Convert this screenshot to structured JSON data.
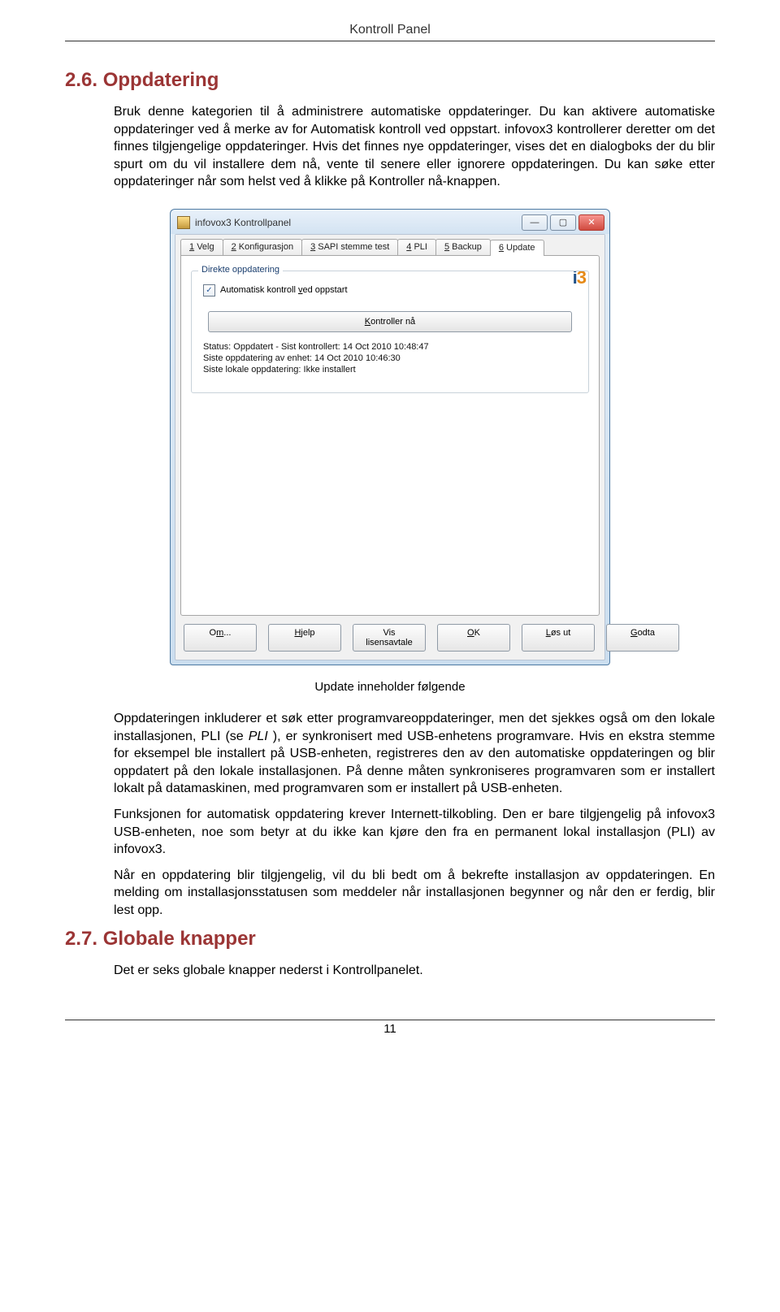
{
  "header": {
    "title": "Kontroll Panel"
  },
  "section26": {
    "heading": "2.6. Oppdatering",
    "p1": "Bruk denne kategorien til å administrere automatiske oppdateringer. Du kan aktivere automatiske oppdateringer ved å merke av for Automatisk kontroll ved oppstart. infovox3 kontrollerer deretter om det finnes tilgjengelige oppdateringer. Hvis det finnes nye oppdateringer, vises det en dialogboks der du blir spurt om du vil installere dem nå, vente til senere eller ignorere oppdateringen. Du kan søke etter oppdateringer når som helst ved å klikke på Kontroller nå-knappen."
  },
  "screenshot": {
    "window_title": "infovox3 Kontrollpanel",
    "logo": {
      "i": "i",
      "three": "3"
    },
    "tabs": [
      {
        "label": "1 Velg"
      },
      {
        "label": "2 Konfigurasjon"
      },
      {
        "label": "3 SAPI stemme test"
      },
      {
        "label": "4 PLI"
      },
      {
        "label": "5 Backup"
      },
      {
        "label": "6 Update"
      }
    ],
    "group_title": "Direkte oppdatering",
    "checkbox_label": "Automatisk kontroll ved oppstart",
    "check_now_label": "Kontroller nå",
    "status1": "Status: Oppdatert - Sist kontrollert: 14 Oct 2010 10:48:47",
    "status2": "Siste oppdatering av enhet: 14 Oct 2010 10:46:30",
    "status3": "Siste lokale oppdatering: Ikke installert",
    "buttons": {
      "om": "Om...",
      "hjelp": "Hjelp",
      "vis": "Vis lisensavtale",
      "ok": "OK",
      "los": "Løs ut",
      "godta": "Godta"
    }
  },
  "caption": "Update inneholder følgende",
  "after": {
    "p1a": "Oppdateringen inkluderer et søk etter programvareoppdateringer, men det sjekkes også om den lokale installasjonen, PLI (se ",
    "p1_pli": "PLI",
    "p1b": " ), er synkronisert med USB-enhetens programvare. Hvis en ekstra stemme for eksempel ble installert på USB-enheten, registreres den av den automatiske oppdateringen og blir oppdatert på den lokale installasjonen. På denne måten synkroniseres programvaren som er installert lokalt på datamaskinen, med programvaren som er installert på USB-enheten.",
    "p2": "Funksjonen for automatisk oppdatering krever Internett-tilkobling. Den er bare tilgjengelig på infovox3 USB-enheten, noe som betyr at du ikke kan kjøre den fra en permanent lokal installasjon (PLI) av infovox3.",
    "p3": "Når en oppdatering blir tilgjengelig, vil du bli bedt om å bekrefte installasjon av oppdateringen. En melding om installasjonsstatusen som meddeler når installasjonen begynner og når den er ferdig, blir lest opp."
  },
  "section27": {
    "heading": "2.7. Globale knapper",
    "p1": "Det er seks globale knapper nederst i Kontrollpanelet."
  },
  "page_number": "11"
}
